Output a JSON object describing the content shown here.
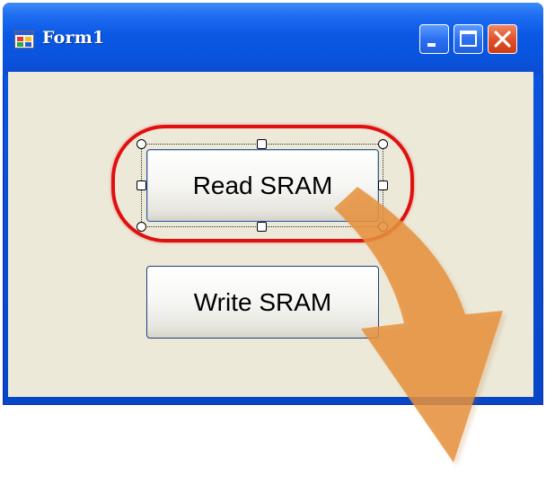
{
  "window": {
    "title": "Form1",
    "controls": {
      "minimize": "minimize-button",
      "maximize": "maximize-button",
      "close": "close-button"
    }
  },
  "form": {
    "buttons": [
      {
        "label": "Read SRAM",
        "selected": true
      },
      {
        "label": "Write SRAM",
        "selected": false
      }
    ]
  },
  "annotation": {
    "highlight_color": "#e01010",
    "arrow_color": "#e6923d"
  },
  "colors": {
    "titlebar": "#0b58e3",
    "client_bg": "#ece9d8",
    "close_button": "#e0522c"
  }
}
